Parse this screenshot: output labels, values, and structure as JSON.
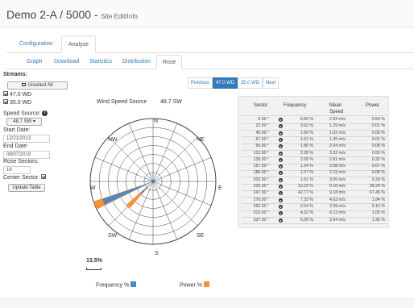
{
  "page": {
    "title": "Demo 2-A / 5000 - ",
    "subtitle": "Site Edit/Info"
  },
  "tabs": [
    {
      "label": "Configuration",
      "active": false
    },
    {
      "label": "Analyze",
      "active": true
    }
  ],
  "subtabs": [
    {
      "label": "Graph",
      "active": false
    },
    {
      "label": "Download",
      "active": false
    },
    {
      "label": "Statistics",
      "active": false
    },
    {
      "label": "Distribution",
      "active": false
    },
    {
      "label": "Rose",
      "active": true
    }
  ],
  "sidebar": {
    "streams_label": "Streams:",
    "unselect_label": "Unselect All",
    "streams": [
      {
        "label": "47.0 WD",
        "checked": true
      },
      {
        "label": "35.0 WD",
        "checked": true
      }
    ],
    "speed_source_label": "Speed Source:",
    "speed_source_value": "48.7 SW",
    "start_date_label": "Start Date:",
    "start_date_value": "12/21/2013",
    "end_date_label": "End Date:",
    "end_date_value": "08/07/2019",
    "rose_sectors_label": "Rose Sectors:",
    "rose_sectors_value": "16",
    "center_sector_label": "Center Sector:",
    "update_label": "Update Table"
  },
  "pager": {
    "previous": "Previous",
    "pages": [
      {
        "label": "47.0 WD",
        "active": true
      },
      {
        "label": "35.0 WD",
        "active": false
      }
    ],
    "next": "Next"
  },
  "chart": {
    "source_label": "Wind Speed Source",
    "source_value": "48.7 SW",
    "directions": [
      "N",
      "NE",
      "E",
      "SE",
      "S",
      "SW",
      "W",
      "NW"
    ],
    "scale_label": "13.5%",
    "legend": [
      {
        "label": "Frequency %",
        "color": "#4a86c8"
      },
      {
        "label": "Power %",
        "color": "#f39237"
      }
    ]
  },
  "table": {
    "headers": [
      "Sector",
      "Frequency",
      "Mean Speed",
      "Power"
    ],
    "rows": [
      {
        "sector": "0.00 °",
        "frequency": "6.60 %",
        "speed": "2.94 m/s",
        "power": "0.54 %"
      },
      {
        "sector": "22.50 °",
        "frequency": "3.62 %",
        "speed": "1.29 m/s",
        "power": "0.01 %"
      },
      {
        "sector": "45.00 °",
        "frequency": "1.60 %",
        "speed": "1.02 m/s",
        "power": "0.00 %"
      },
      {
        "sector": "67.50 °",
        "frequency": "1.61 %",
        "speed": "1.35 m/s",
        "power": "0.01 %"
      },
      {
        "sector": "90.00 °",
        "frequency": "1.80 %",
        "speed": "2.04 m/s",
        "power": "0.08 %"
      },
      {
        "sector": "112.50 °",
        "frequency": "2.28 %",
        "speed": "3.32 m/s",
        "power": "0.50 %"
      },
      {
        "sector": "135.00 °",
        "frequency": "2.09 %",
        "speed": "2.81 m/s",
        "power": "0.32 %"
      },
      {
        "sector": "157.50 °",
        "frequency": "1.24 %",
        "speed": "2.08 m/s",
        "power": "0.07 %"
      },
      {
        "sector": "180.00 °",
        "frequency": "1.07 %",
        "speed": "2.19 m/s",
        "power": "0.08 %"
      },
      {
        "sector": "202.50 °",
        "frequency": "1.61 %",
        "speed": "3.05 m/s",
        "power": "0.29 %"
      },
      {
        "sector": "225.00 °",
        "frequency": "13.29 %",
        "speed": "9.10 m/s",
        "power": "28.24 %"
      },
      {
        "sector": "247.50 °",
        "frequency": "42.77 %",
        "speed": "9.18 m/s",
        "power": "67.45 %"
      },
      {
        "sector": "270.00 °",
        "frequency": "7.33 %",
        "speed": "4.63 m/s",
        "power": "1.84 %"
      },
      {
        "sector": "292.50 °",
        "frequency": "2.54 %",
        "speed": "2.59 m/s",
        "power": "0.15 %"
      },
      {
        "sector": "315.00 °",
        "frequency": "4.32 %",
        "speed": "4.13 m/s",
        "power": "1.05 %"
      },
      {
        "sector": "337.50 °",
        "frequency": "6.26 %",
        "speed": "3.94 m/s",
        "power": "1.36 %"
      }
    ]
  }
}
